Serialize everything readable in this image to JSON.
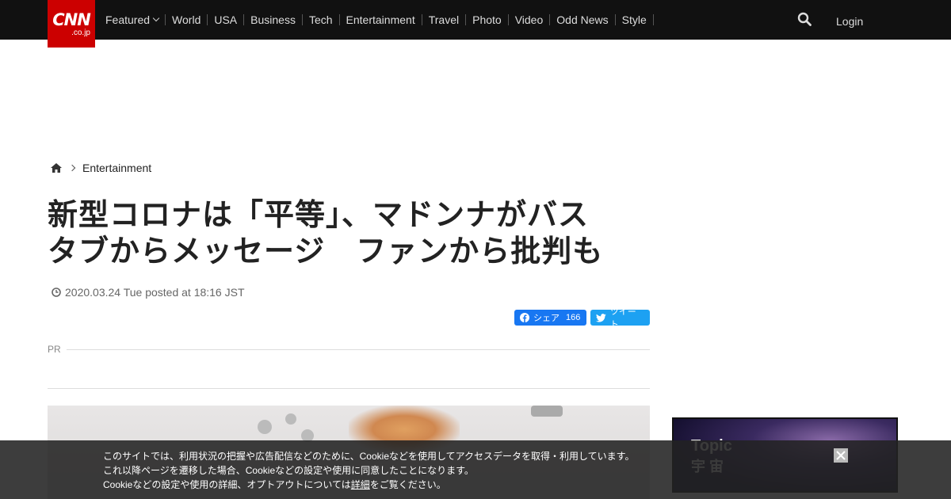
{
  "header": {
    "logo_main": "CNN",
    "logo_sub": ".co.jp",
    "nav": [
      "Featured",
      "World",
      "USA",
      "Business",
      "Tech",
      "Entertainment",
      "Travel",
      "Photo",
      "Video",
      "Odd News",
      "Style"
    ],
    "login": "Login"
  },
  "breadcrumb": {
    "category": "Entertainment"
  },
  "article": {
    "title_line1": "新型コロナは「平等」、マドンナがバス",
    "title_line2": "タブからメッセージ　ファンから批判も",
    "date": "2020.03.24 Tue posted at 18:16 JST",
    "share_fb_label": "シェア",
    "share_fb_count": "166",
    "share_tw_label": "ツイート",
    "pr_label": "PR"
  },
  "sidebar": {
    "topic_label": "Topic",
    "topic_name": "宇 宙"
  },
  "cookie": {
    "line1": "このサイトでは、利用状況の把握や広告配信などのために、Cookieなどを使用してアクセスデータを取得・利用しています。",
    "line2": "これ以降ページを遷移した場合、Cookieなどの設定や使用に同意したことになります。",
    "line3_pre": "Cookieなどの設定や使用の詳細、オプトアウトについては",
    "line3_link": "詳細",
    "line3_post": "をご覧ください。"
  },
  "colors": {
    "brand_red": "#cc0000",
    "header_bg": "#111111",
    "facebook": "#1877f2",
    "twitter": "#1da1f2"
  }
}
